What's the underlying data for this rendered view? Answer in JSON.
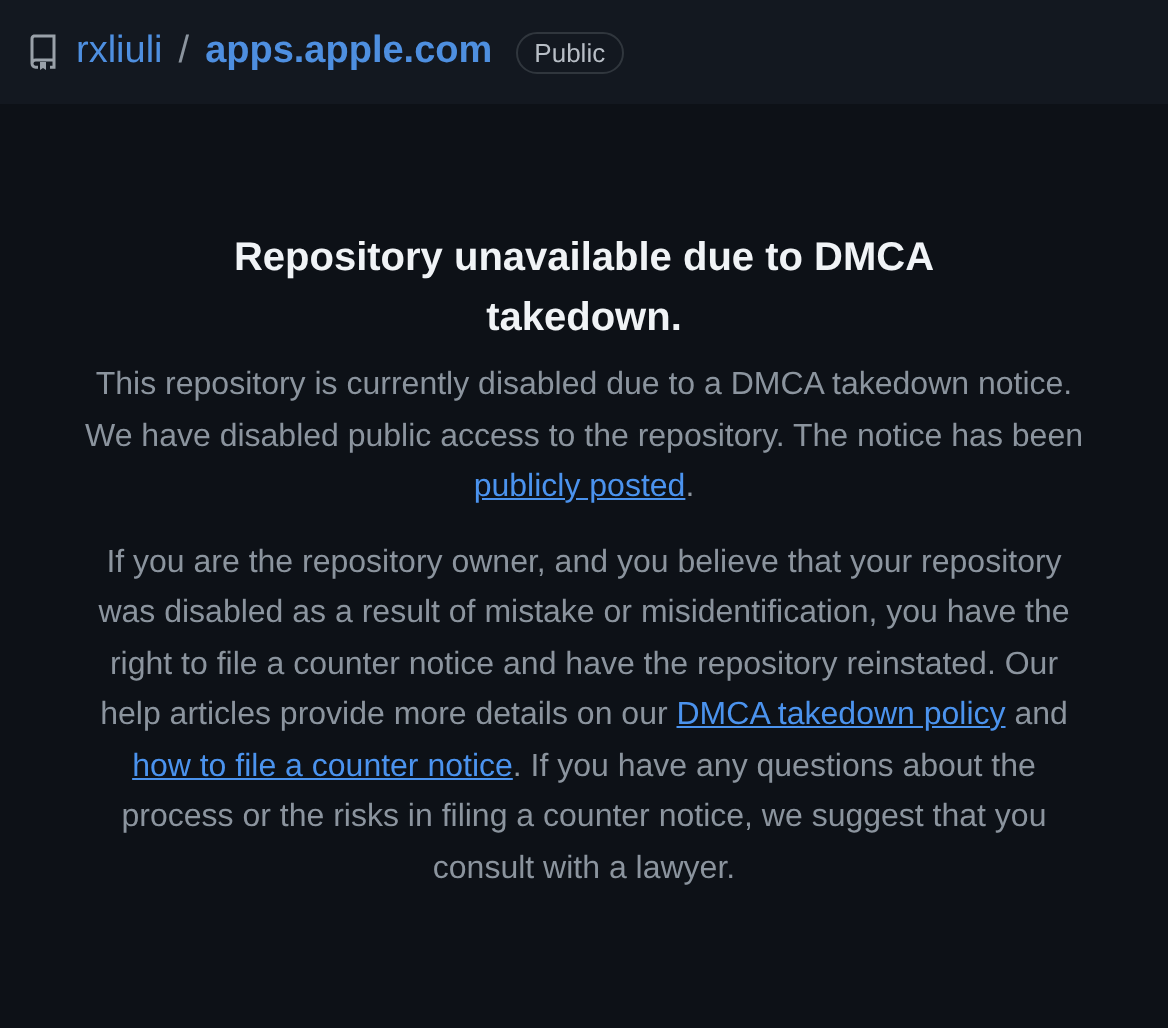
{
  "header": {
    "owner": "rxliuli",
    "separator": "/",
    "repo": "apps.apple.com",
    "visibility": "Public"
  },
  "notice": {
    "title": "Repository unavailable due to DMCA takedown.",
    "paragraphs": [
      {
        "parts": [
          {
            "kind": "text",
            "text": "This repository is currently disabled due to a DMCA takedown notice. We have disabled public access to the repository. The notice has been "
          },
          {
            "kind": "link",
            "text": "publicly posted"
          },
          {
            "kind": "text",
            "text": "."
          }
        ]
      },
      {
        "parts": [
          {
            "kind": "text",
            "text": "If you are the repository owner, and you believe that your repository was disabled as a result of mistake or misidentification, you have the right to file a counter notice and have the repository reinstated. Our help articles provide more details on our "
          },
          {
            "kind": "link",
            "text": "DMCA takedown policy"
          },
          {
            "kind": "text",
            "text": " and "
          },
          {
            "kind": "link",
            "text": "how to file a counter notice"
          },
          {
            "kind": "text",
            "text": ". If you have any questions about the process or the risks in filing a counter notice, we suggest that you consult with a lawyer."
          }
        ]
      }
    ]
  }
}
